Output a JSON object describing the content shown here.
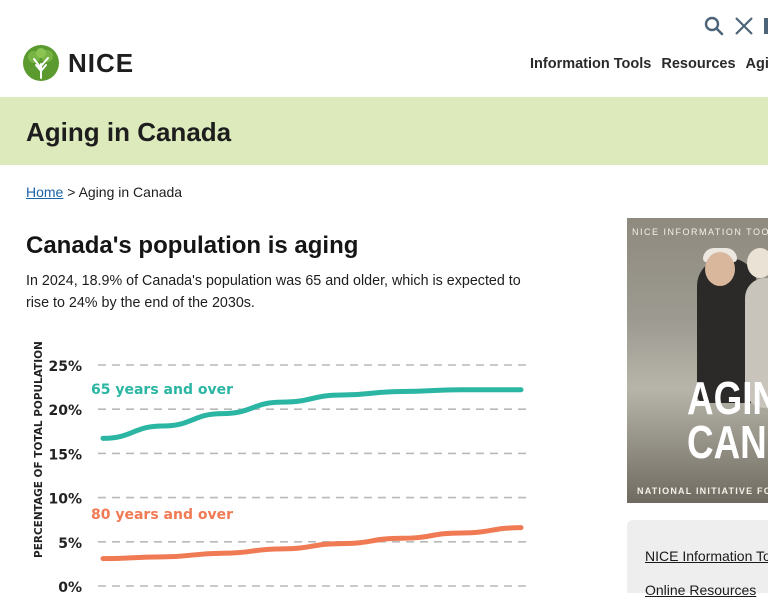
{
  "header": {
    "logo_text": "NICE",
    "nav": [
      "Information Tools",
      "Resources",
      "Aging in"
    ],
    "icons": [
      "search-icon",
      "x-social-icon"
    ]
  },
  "banner": {
    "title": "Aging in Canada"
  },
  "breadcrumb": {
    "home": "Home",
    "separator": ">",
    "current": "Aging in Canada"
  },
  "section": {
    "title": "Canada's population is aging",
    "intro": "In 2024, 18.9% of Canada's population was 65 and older, which is expected to rise to 24% by the end of the 2030s."
  },
  "chart_data": {
    "type": "line",
    "ylabel": "PERCENTAGE OF TOTAL POPULATION",
    "ylim": [
      0,
      25
    ],
    "yticks": [
      "0%",
      "5%",
      "10%",
      "15%",
      "20%",
      "25%"
    ],
    "grid": true,
    "x": [
      0,
      1,
      2,
      3,
      4,
      5,
      6,
      7
    ],
    "series": [
      {
        "name": "65 years and over",
        "color": "#2bb5a3",
        "values": [
          16.7,
          18.1,
          19.5,
          20.8,
          21.6,
          22.0,
          22.2,
          22.2
        ]
      },
      {
        "name": "80 years and over",
        "color": "#f07a54",
        "values": [
          3.1,
          3.3,
          3.7,
          4.2,
          4.8,
          5.4,
          6.0,
          6.6
        ]
      }
    ]
  },
  "promo": {
    "top_text": "NICE INFORMATION TOO",
    "big_line1": "AGIN",
    "big_line2": "CAN",
    "bottom_text": "NATIONAL INITIATIVE FO"
  },
  "sidebar": {
    "links": [
      "NICE Information Too",
      "Online Resources"
    ]
  }
}
